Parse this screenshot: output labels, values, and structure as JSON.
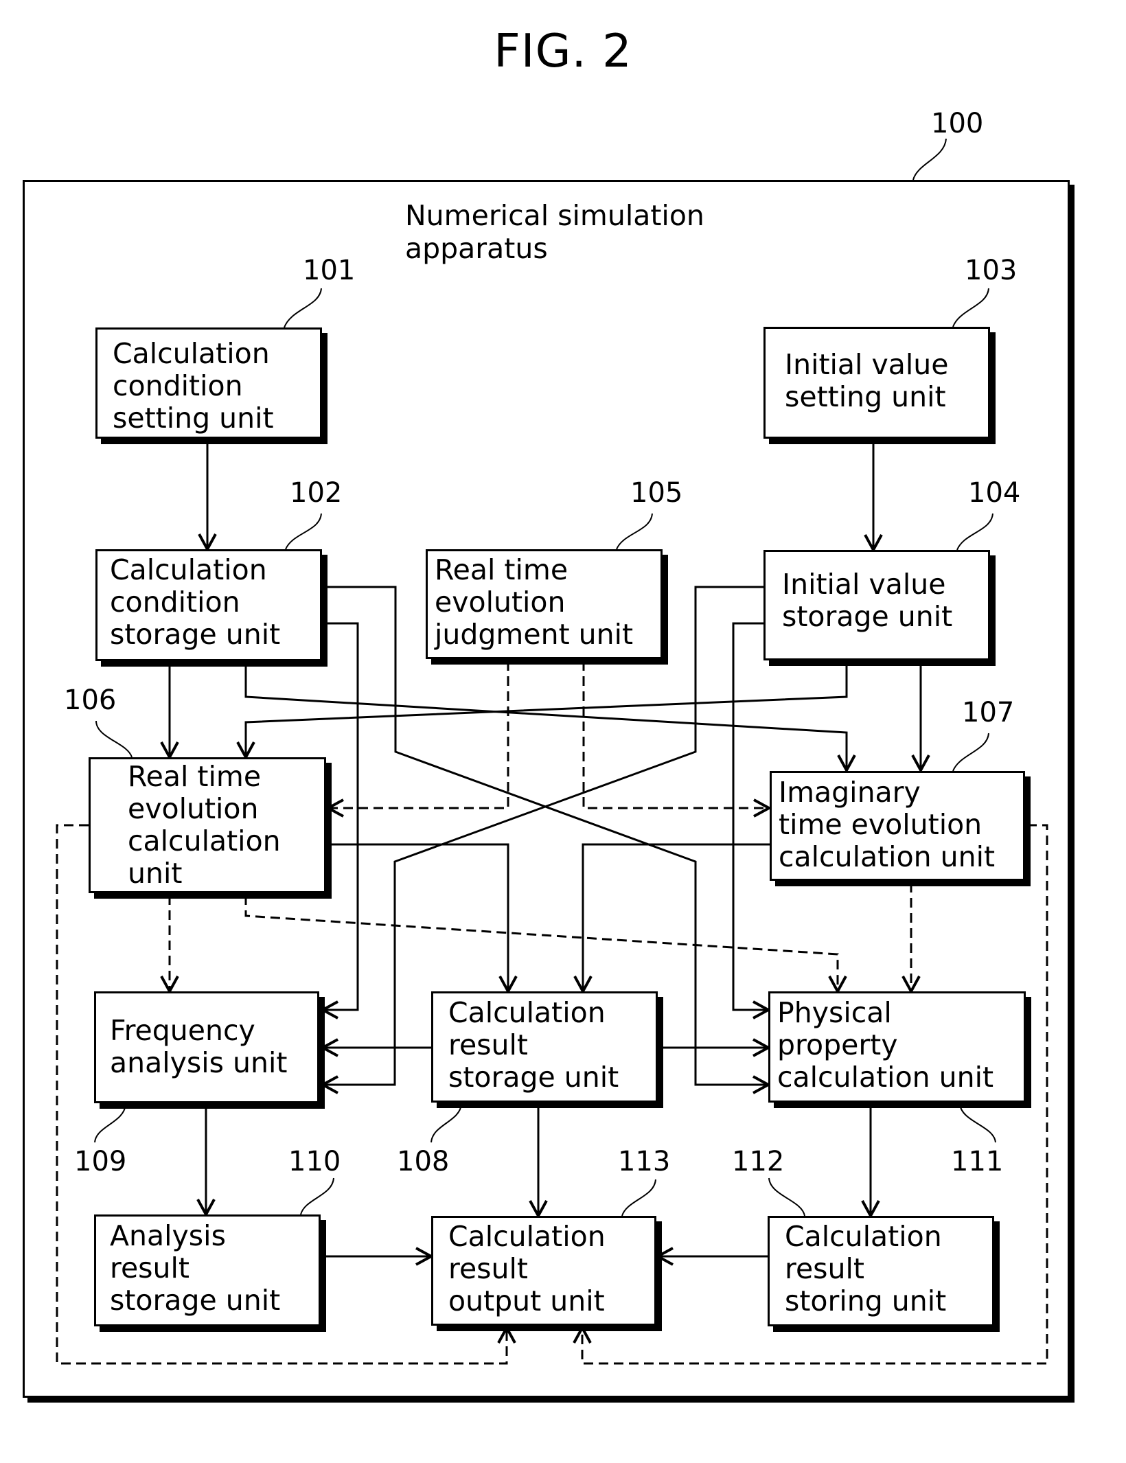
{
  "figure": {
    "title": "FIG. 2",
    "apparatus_ref": "100",
    "apparatus_label": "Numerical simulation\napparatus"
  },
  "units": [
    {
      "id": "101",
      "label": "Calculation\ncondition\nsetting unit"
    },
    {
      "id": "102",
      "label": "Calculation\ncondition\nstorage unit"
    },
    {
      "id": "103",
      "label": "Initial value\nsetting unit"
    },
    {
      "id": "104",
      "label": "Initial value\nstorage unit"
    },
    {
      "id": "105",
      "label": "Real time\nevolution\njudgment unit"
    },
    {
      "id": "106",
      "label": "Real time\nevolution\ncalculation\nunit"
    },
    {
      "id": "107",
      "label": "Imaginary\ntime evolution\ncalculation unit"
    },
    {
      "id": "108",
      "label": "Calculation\nresult\nstorage unit"
    },
    {
      "id": "109",
      "label": "Frequency\nanalysis unit"
    },
    {
      "id": "110",
      "label": "Analysis\nresult\nstorage unit"
    },
    {
      "id": "111",
      "label": "Physical\nproperty\ncalculation unit"
    },
    {
      "id": "112",
      "label": "Calculation\nresult\nstoring unit"
    },
    {
      "id": "113",
      "label": "Calculation\nresult\noutput unit"
    }
  ],
  "connections": [
    {
      "from": "101",
      "to": "102",
      "style": "solid"
    },
    {
      "from": "103",
      "to": "104",
      "style": "solid"
    },
    {
      "from": "102",
      "to": "106",
      "style": "solid"
    },
    {
      "from": "102",
      "to": "107",
      "style": "solid"
    },
    {
      "from": "102",
      "to": "109",
      "style": "solid"
    },
    {
      "from": "102",
      "to": "111",
      "style": "solid"
    },
    {
      "from": "104",
      "to": "106",
      "style": "solid"
    },
    {
      "from": "104",
      "to": "107",
      "style": "solid"
    },
    {
      "from": "104",
      "to": "109",
      "style": "solid"
    },
    {
      "from": "104",
      "to": "111",
      "style": "solid"
    },
    {
      "from": "105",
      "to": "106",
      "style": "dashed"
    },
    {
      "from": "105",
      "to": "107",
      "style": "dashed"
    },
    {
      "from": "106",
      "to": "108",
      "style": "solid"
    },
    {
      "from": "106",
      "to": "109",
      "style": "dashed"
    },
    {
      "from": "106",
      "to": "111",
      "style": "dashed"
    },
    {
      "from": "106",
      "to": "113",
      "style": "dashed"
    },
    {
      "from": "107",
      "to": "108",
      "style": "solid"
    },
    {
      "from": "107",
      "to": "111",
      "style": "dashed"
    },
    {
      "from": "107",
      "to": "113",
      "style": "dashed"
    },
    {
      "from": "108",
      "to": "109",
      "style": "solid"
    },
    {
      "from": "108",
      "to": "111",
      "style": "solid"
    },
    {
      "from": "108",
      "to": "113",
      "style": "solid"
    },
    {
      "from": "109",
      "to": "110",
      "style": "solid"
    },
    {
      "from": "110",
      "to": "113",
      "style": "solid"
    },
    {
      "from": "111",
      "to": "112",
      "style": "solid"
    },
    {
      "from": "112",
      "to": "113",
      "style": "solid"
    }
  ]
}
